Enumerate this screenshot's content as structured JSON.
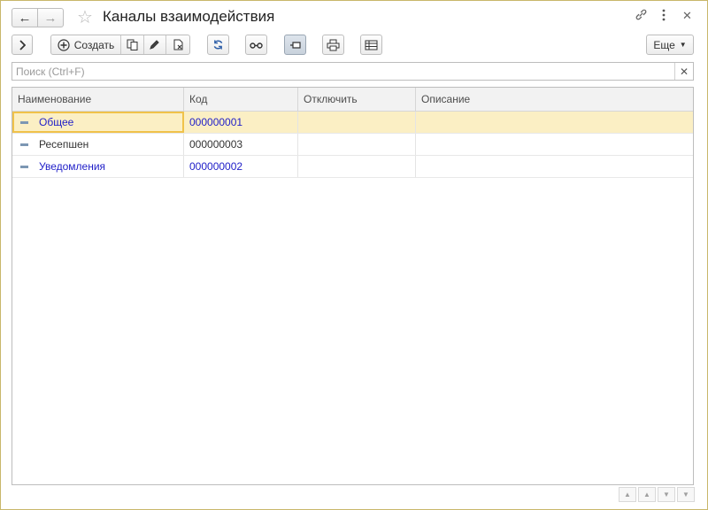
{
  "window": {
    "title": "Каналы взаимодействия"
  },
  "icons": {
    "back": "arrow-left-icon",
    "forward": "arrow-right-icon",
    "favorite": "star-icon",
    "link": "link-icon",
    "more": "kebab-menu-icon",
    "close": "close-icon"
  },
  "toolbar": {
    "create_label": "Создать",
    "more_label": "Еще"
  },
  "search": {
    "placeholder": "Поиск (Ctrl+F)",
    "value": ""
  },
  "table": {
    "columns": [
      "Наименование",
      "Код",
      "Отключить",
      "Описание"
    ],
    "rows": [
      {
        "name": "Общее",
        "code": "000000001",
        "disabled": "",
        "description": "",
        "selected": true
      },
      {
        "name": "Ресепшен",
        "code": "000000003",
        "disabled": "",
        "description": "",
        "selected": false
      },
      {
        "name": "Уведомления",
        "code": "000000002",
        "disabled": "",
        "description": "",
        "selected": false
      }
    ]
  },
  "colors": {
    "window_border": "#c9b76a",
    "selected_row": "#fbefc4",
    "selected_cell_border": "#f0c24a",
    "link_text": "#1f1ec8"
  }
}
